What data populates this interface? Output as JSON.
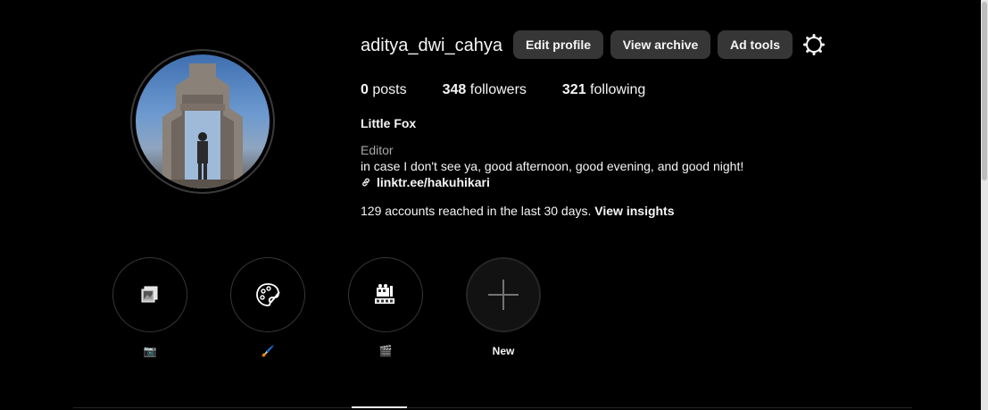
{
  "profile": {
    "username": "aditya_dwi_cahya",
    "buttons": {
      "edit": "Edit profile",
      "archive": "View archive",
      "ads": "Ad tools"
    },
    "settings_icon": "gear-icon",
    "stats": {
      "posts_count": "0",
      "posts_label": "posts",
      "followers_count": "348",
      "followers_label": "followers",
      "following_count": "321",
      "following_label": "following"
    },
    "full_name": "Little Fox",
    "category": "Editor",
    "bio": "in case I don't see ya, good afternoon, good evening, and good night!",
    "link": "linktr.ee/hakuhikari",
    "insights_text": "129 accounts reached in the last 30 days.",
    "insights_link": "View insights"
  },
  "highlights": [
    {
      "label": "📷",
      "icon": "photo-frames-icon"
    },
    {
      "label": "🖌️",
      "icon": "palette-icon"
    },
    {
      "label": "🎬",
      "icon": "film-equipment-icon"
    },
    {
      "label": "New",
      "icon": "plus-icon"
    }
  ],
  "colors": {
    "background": "#000000",
    "button": "#363636",
    "muted_text": "#a8a8a8",
    "text": "#f5f5f5"
  }
}
